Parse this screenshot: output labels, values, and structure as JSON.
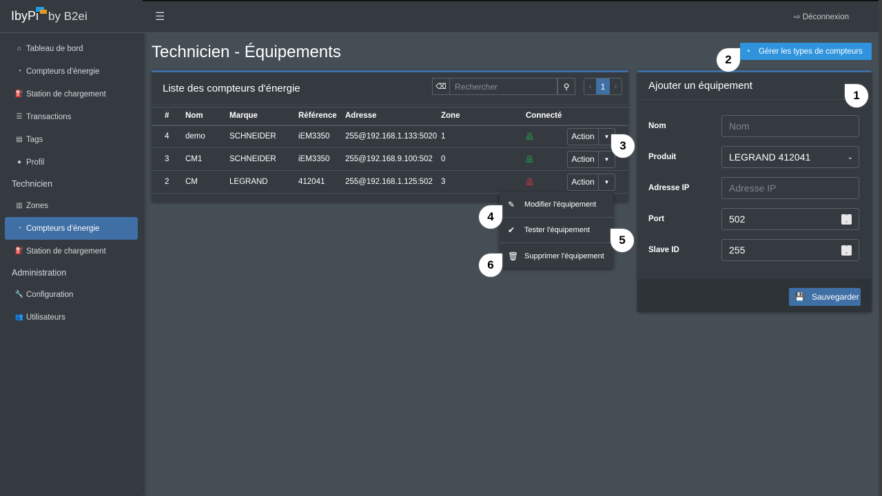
{
  "brand": {
    "logo": "IbyPi",
    "by": "by B2ei"
  },
  "sidebar": {
    "items": [
      {
        "label": "Tableau de bord",
        "icon": "home-icon"
      },
      {
        "label": "Compteurs d'énergie",
        "icon": "gauge-icon"
      },
      {
        "label": "Station de chargement",
        "icon": "charging-station-icon"
      },
      {
        "label": "Transactions",
        "icon": "list-icon"
      },
      {
        "label": "Tags",
        "icon": "id-card-icon"
      },
      {
        "label": "Profil",
        "icon": "user-icon"
      }
    ],
    "section_technicien": "Technicien",
    "tech_items": [
      {
        "label": "Zones",
        "icon": "map-icon"
      },
      {
        "label": "Compteurs d'énergie",
        "icon": "gauge-icon",
        "active": true
      },
      {
        "label": "Station de chargement",
        "icon": "charging-station-icon"
      }
    ],
    "section_admin": "Administration",
    "admin_items": [
      {
        "label": "Configuration",
        "icon": "wrench-icon"
      },
      {
        "label": "Utilisateurs",
        "icon": "users-icon"
      }
    ]
  },
  "topbar": {
    "logout": "Déconnexion"
  },
  "page": {
    "title": "Technicien - Équipements",
    "manage_types": "Gérer les types de compteurs"
  },
  "list": {
    "title": "Liste des compteurs d'énergie",
    "search_placeholder": "Rechercher",
    "page": "1",
    "columns": [
      "#",
      "Nom",
      "Marque",
      "Référence",
      "Adresse",
      "Zone",
      "Connecté"
    ],
    "rows": [
      {
        "id": "4",
        "nom": "demo",
        "marque": "SCHNEIDER",
        "ref": "iEM3350",
        "adresse": "255@192.168.1.133:5020",
        "zone": "1",
        "connected": true,
        "action": "Action"
      },
      {
        "id": "3",
        "nom": "CM1",
        "marque": "SCHNEIDER",
        "ref": "iEM3350",
        "adresse": "255@192.168.9.100:502",
        "zone": "0",
        "connected": true,
        "action": "Action"
      },
      {
        "id": "2",
        "nom": "CM",
        "marque": "LEGRAND",
        "ref": "412041",
        "adresse": "255@192.168.1.125:502",
        "zone": "3",
        "connected": false,
        "action": "Action"
      }
    ]
  },
  "menu": {
    "items": [
      "Modifier l'équipement",
      "Tester l'équipement",
      "Supprimer l'équipement"
    ]
  },
  "form": {
    "title": "Ajouter un équipement",
    "nom_label": "Nom",
    "nom_placeholder": "Nom",
    "produit_label": "Produit",
    "produit_value": "LEGRAND 412041",
    "ip_label": "Adresse IP",
    "ip_placeholder": "Adresse IP",
    "port_label": "Port",
    "port_value": "502",
    "slave_label": "Slave ID",
    "slave_value": "255",
    "save": "Sauvegarder"
  },
  "callouts": [
    "1",
    "2",
    "3",
    "4",
    "5",
    "6"
  ],
  "colors": {
    "accent": "#3f6fa4",
    "info": "#2f94dd",
    "connected": "#28a745",
    "disconnected": "#dc3545"
  }
}
